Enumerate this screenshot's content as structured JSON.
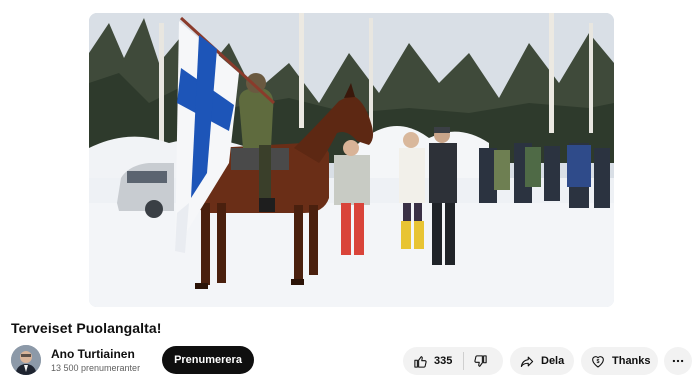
{
  "video": {
    "title": "Terveiset Puolangalta!"
  },
  "channel": {
    "name": "Ano Turtiainen",
    "subscribers": "13 500 prenumeranter",
    "subscribe_label": "Prenumerera"
  },
  "actions": {
    "like_count": "335",
    "share_label": "Dela",
    "thanks_label": "Thanks"
  },
  "colors": {
    "subscribe_bg": "#0f0f0f",
    "pill_bg": "#f2f2f2",
    "flag_blue": "#1d55b8"
  },
  "icons": [
    "thumbs-up-icon",
    "thumbs-down-icon",
    "share-arrow-icon",
    "thanks-dollar-icon",
    "more-dots-icon"
  ]
}
